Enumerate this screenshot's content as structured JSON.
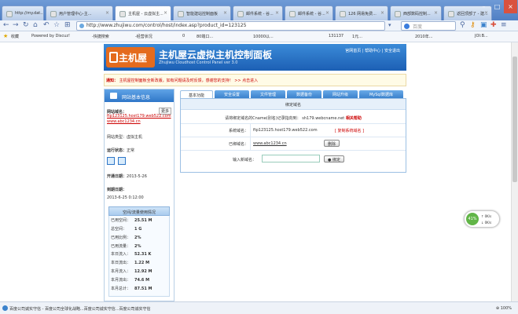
{
  "browser": {
    "tabs": [
      {
        "label": "http://my.dat..."
      },
      {
        "label": "用户管理中心-主..."
      },
      {
        "label": "主机屋 - 云虚拟主..."
      },
      {
        "label": "智能建站控制面板"
      },
      {
        "label": "邮件系统 - 谷..."
      },
      {
        "label": "邮件系统 - 谷..."
      },
      {
        "label": "126 网易免费..."
      },
      {
        "label": "西部数码控制..."
      },
      {
        "label": "返回顶部了 - 建..."
      }
    ],
    "url": "http://www.zhujiwu.com/control/host/index.asp?product_id=123125",
    "search_placeholder": "百度",
    "bookmarks": [
      "收藏",
      "Powered by Discuz!",
      "-快捷搜索",
      "-经营状况",
      "0",
      "80端口...",
      "10000以...",
      "131137",
      "1元...",
      "2010年...",
      "JOI:B..."
    ],
    "status_message": "百度公司诚实守信 - 百度公司全球化战略...百度公司诚实守信...百度公司诚实守信",
    "status_zoom": "100%"
  },
  "panel": {
    "logo_text": "主机屋",
    "title": "主机屋云虚拟主机控制面板",
    "subtitle": "Zhujiwu Cloudhost Control Panel ver 3.0",
    "header_links": "官网首页 | 帮助中心 | 安全退出",
    "notice_label": "通知：",
    "notice_text": "主机屋控制面板全新改版，如有问题请及时反馈，感谢您的支持！ >> 点击进入",
    "left_title": "网站基本信息",
    "domain_label": "网站域名：",
    "more_button": "更多",
    "domain_link1": "ftp123125.host179.web522.com",
    "domain_link2": "www.abc1234.cn",
    "host_type": "网站类型：虚拟主机",
    "run_state_label": "运行状态：",
    "run_state_value": "正常",
    "open_date_label": "开通日期：",
    "open_date_value": "2013-5-26",
    "expire_label": "到期日期：",
    "expire_value": "2013-6-25 0:12:00",
    "stats_title": "空间/流量使用情况",
    "stats": [
      {
        "label": "已用空间：",
        "value": "25.51 M"
      },
      {
        "label": "总空间：",
        "value": "1 G"
      },
      {
        "label": "已用比例：",
        "value": "2%"
      },
      {
        "label": "已用流量：",
        "value": "2%"
      },
      {
        "label": "本日流入：",
        "value": "52.31 K"
      },
      {
        "label": "本日流出：",
        "value": "1.22 M"
      },
      {
        "label": "本月流入：",
        "value": "12.92 M"
      },
      {
        "label": "本月流出：",
        "value": "74.6 M"
      },
      {
        "label": "本月总计：",
        "value": "87.51 M"
      }
    ],
    "tabs": [
      "基本功能",
      "安全设置",
      "文件管理",
      "数据备份",
      "网站升级",
      "MySql数据库"
    ],
    "box_title": "绑定域名",
    "cname_text": "请将绑定域名的Cname(别名)记录指向到：",
    "cname_target": "sh179.webcname.net",
    "cname_help": "相关帮助",
    "sys_domain_label": "系统域名：",
    "sys_domain_value": "ftp123125.host179.web522.com",
    "sys_domain_action": "[ 复制系统域名 ]",
    "bound_label": "已绑域名：",
    "bound_value": "www.abc1234.cn",
    "delete_button": "删除",
    "input_label": "输入新域名：",
    "bind_button": "绑定",
    "widget_up": "0K/s",
    "widget_down": "0K/s",
    "widget_percent": "41%"
  }
}
